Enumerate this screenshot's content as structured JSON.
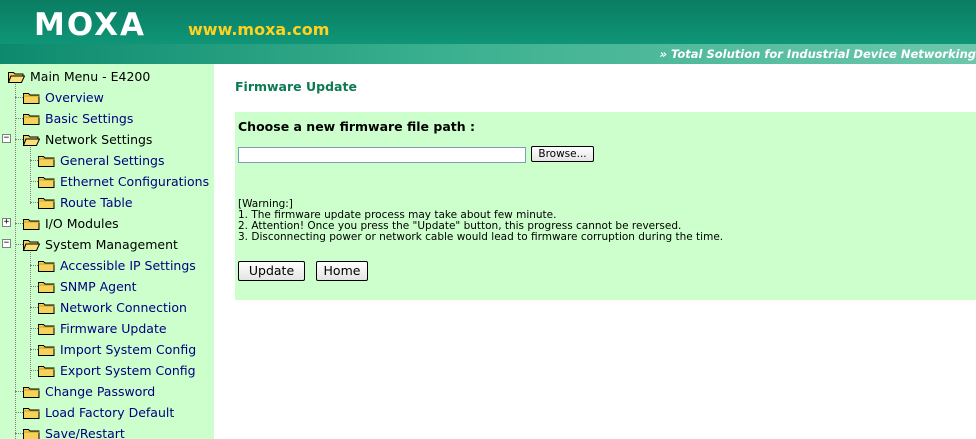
{
  "header": {
    "logo": "MOXA",
    "url": "www.moxa.com",
    "tagline": "» Total Solution for Industrial Device Networking",
    "colors": {
      "header_bg": "#0d8a6e",
      "url_color": "#ffd21f"
    }
  },
  "sidebar": {
    "root_label": "Main Menu - E4200",
    "items": [
      {
        "label": "Overview",
        "type": "link"
      },
      {
        "label": "Basic Settings",
        "type": "link"
      },
      {
        "label": "Network Settings",
        "type": "section",
        "expander": "minus"
      },
      {
        "label": "General Settings",
        "type": "link"
      },
      {
        "label": "Ethernet Configurations",
        "type": "link"
      },
      {
        "label": "Route Table",
        "type": "link"
      },
      {
        "label": "I/O Modules",
        "type": "section",
        "expander": "plus"
      },
      {
        "label": "System Management",
        "type": "section",
        "expander": "minus"
      },
      {
        "label": "Accessible IP Settings",
        "type": "link"
      },
      {
        "label": "SNMP Agent",
        "type": "link"
      },
      {
        "label": "Network Connection",
        "type": "link"
      },
      {
        "label": "Firmware Update",
        "type": "link"
      },
      {
        "label": "Import System Config",
        "type": "link"
      },
      {
        "label": "Export System Config",
        "type": "link"
      },
      {
        "label": "Change Password",
        "type": "link"
      },
      {
        "label": "Load Factory Default",
        "type": "link"
      },
      {
        "label": "Save/Restart",
        "type": "link"
      }
    ],
    "colors": {
      "bg": "#ccffcc",
      "link": "#00007f"
    }
  },
  "main": {
    "title": "Firmware Update",
    "heading": "Choose a new firmware file path :",
    "file_input_value": "",
    "browse_label": "Browse...",
    "warning_lines": [
      "[Warning:]",
      "1. The firmware update process may take about few minute.",
      "2. Attention! Once you press the \"Update\" button, this progress cannot be reversed.",
      "3. Disconnecting power or network cable would lead to firmware corruption during the time."
    ],
    "update_label": "Update",
    "home_label": "Home",
    "colors": {
      "title": "#0d7a52",
      "panel_bg": "#ccffcc"
    }
  }
}
